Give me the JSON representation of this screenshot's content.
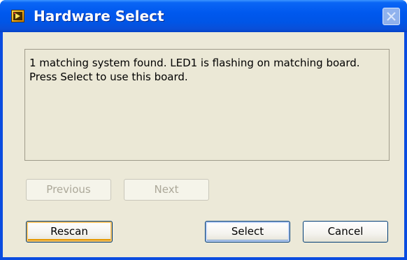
{
  "window": {
    "title": "Hardware Select",
    "icon": "labview-app-icon",
    "close_icon": "close-icon"
  },
  "message": {
    "line1": "1 matching system found. LED1 is flashing on matching board.",
    "line2": "Press Select to use this board."
  },
  "buttons": {
    "previous": "Previous",
    "next": "Next",
    "rescan": "Rescan",
    "select": "Select",
    "cancel": "Cancel"
  },
  "colors": {
    "titlebar": "#0058ee",
    "client_bg": "#ece9d8",
    "disabled_text": "#aca899"
  }
}
